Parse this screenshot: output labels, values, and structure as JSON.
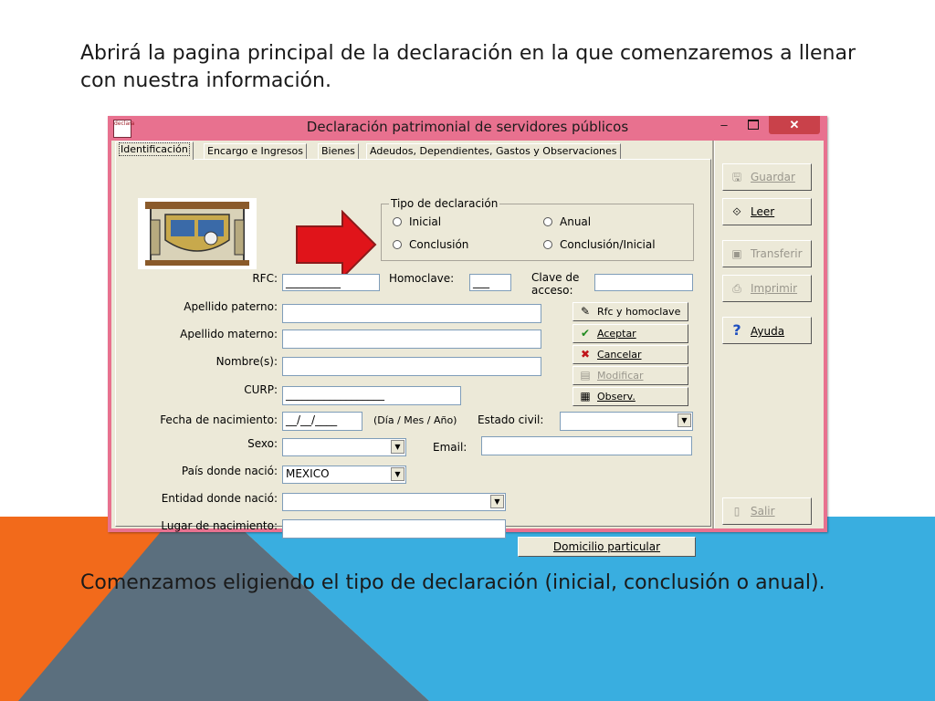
{
  "slide": {
    "intro": "Abrirá la pagina principal de la declaración en la que comenzaremos a llenar con nuestra información.",
    "caption": "Comenzamos eligiendo el tipo de declaración (inicial, conclusión o anual)."
  },
  "window": {
    "title": "Declaración patrimonial de servidores públicos",
    "icon_text": "declara",
    "controls": {
      "minimize": "–",
      "close": "✕"
    }
  },
  "tabs": [
    {
      "label": "Identificación",
      "active": true
    },
    {
      "label": "Encargo e Ingresos"
    },
    {
      "label": "Bienes"
    },
    {
      "label": "Adeudos, Dependientes, Gastos y Observaciones"
    }
  ],
  "tipo_declaracion": {
    "legend": "Tipo de declaración",
    "options": [
      "Inicial",
      "Anual",
      "Conclusión",
      "Conclusión/Inicial"
    ]
  },
  "form": {
    "rfc": {
      "label": "RFC:",
      "value": "__________"
    },
    "homoclave": {
      "label": "Homoclave:",
      "value": "___"
    },
    "clave_acceso": {
      "label_line1": "Clave de",
      "label_line2": "acceso:",
      "value": ""
    },
    "apellido_paterno": {
      "label": "Apellido paterno:",
      "value": ""
    },
    "apellido_materno": {
      "label": "Apellido materno:",
      "value": ""
    },
    "nombres": {
      "label": "Nombre(s):",
      "value": ""
    },
    "curp": {
      "label": "CURP:",
      "value": "__________________"
    },
    "fecha_nacimiento": {
      "label": "Fecha de nacimiento:",
      "value": "__/__/____",
      "hint": "(Día / Mes / Año)"
    },
    "estado_civil": {
      "label": "Estado civil:",
      "value": ""
    },
    "sexo": {
      "label": "Sexo:",
      "value": ""
    },
    "email": {
      "label": "Email:",
      "value": ""
    },
    "pais_nacio": {
      "label": "País donde nació:",
      "value": "MEXICO"
    },
    "entidad_nacio": {
      "label": "Entidad donde nació:",
      "value": ""
    },
    "lugar_nacimiento": {
      "label": "Lugar de nacimiento:",
      "value": ""
    }
  },
  "inner_buttons": {
    "rfc_homoclave": "Rfc y homoclave",
    "aceptar": "Aceptar",
    "cancelar": "Cancelar",
    "modificar": "Modificar",
    "observ": "Observ.",
    "domicilio": "Domicilio particular"
  },
  "side_buttons": {
    "guardar": "Guardar",
    "leer": "Leer",
    "transferir": "Transferir",
    "imprimir": "Imprimir",
    "ayuda": "Ayuda",
    "salir": "Salir"
  },
  "colors": {
    "slide_orange": "#f26a1b",
    "slide_blue": "#39aee0",
    "slide_gray": "#5b6f7e",
    "window_frame": "#e8718f",
    "close_button": "#c9414a",
    "dialog_face": "#ece9d8",
    "annotation_arrow": "#e0141a"
  },
  "icons": {
    "guardar": "save-icon",
    "leer": "read-icon",
    "transferir": "transfer-icon",
    "imprimir": "print-icon",
    "ayuda": "help-icon",
    "salir": "exit-icon",
    "rfc_homoclave": "pencil-icon",
    "aceptar": "check-icon",
    "cancelar": "x-icon",
    "modificar": "edit-icon",
    "observ": "notes-icon",
    "arrow": "red-arrow-icon"
  }
}
